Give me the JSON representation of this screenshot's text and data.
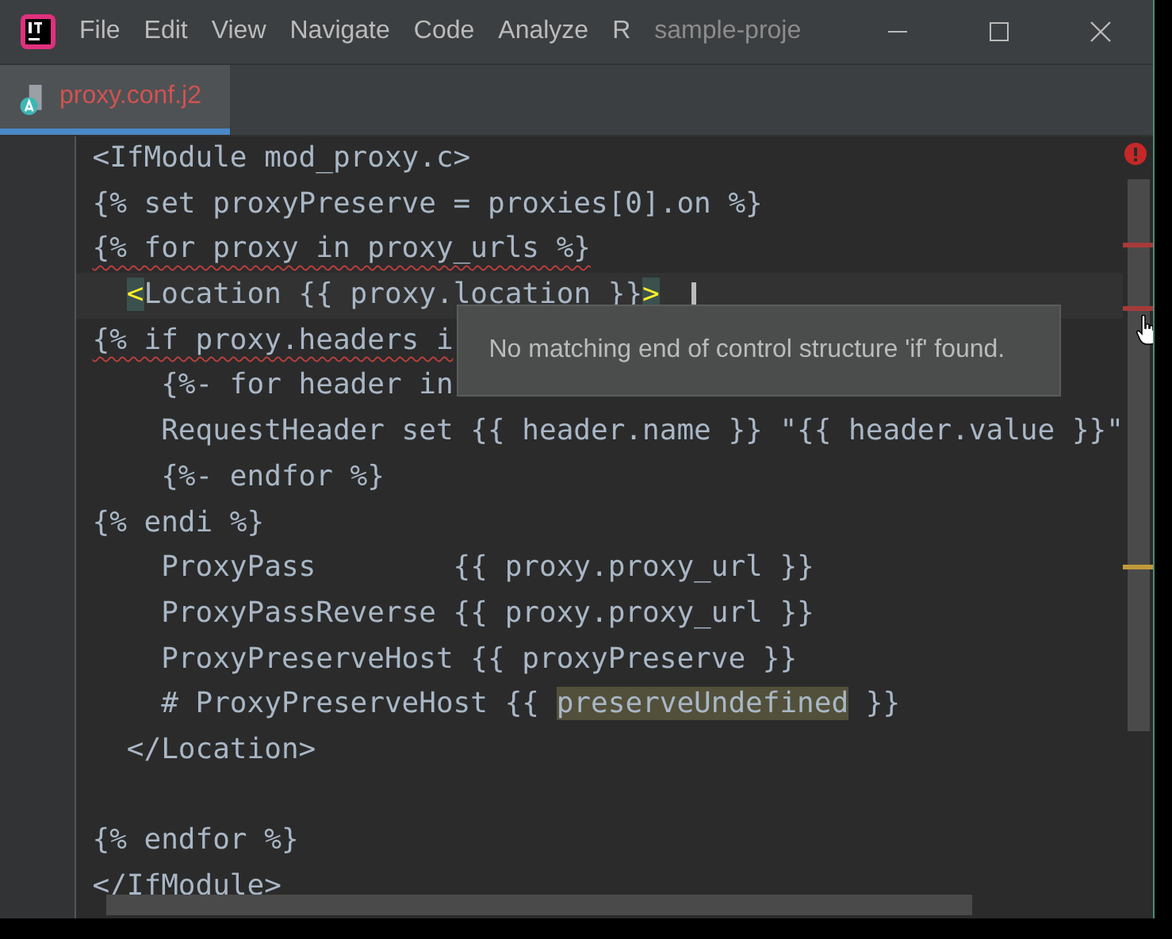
{
  "menu": [
    "File",
    "Edit",
    "View",
    "Navigate",
    "Code",
    "Analyze",
    "R"
  ],
  "project_title": "sample-proje",
  "tabs": [
    {
      "label": "proxy.conf.j2",
      "selected": true
    }
  ],
  "editor": {
    "lines": [
      {
        "segments": [
          {
            "text": "<IfModule mod_proxy.c>",
            "kind": "text"
          }
        ],
        "current": false,
        "error": false
      },
      {
        "segments": [
          {
            "text": "{% set proxyPreserve = proxies[0].on %}",
            "kind": "text"
          }
        ],
        "current": false,
        "error": false
      },
      {
        "segments": [
          {
            "text": "{% for proxy in proxy_urls %}",
            "kind": "text"
          }
        ],
        "current": false,
        "error": true
      },
      {
        "segments": [
          {
            "text": "  <",
            "kind": "brace-match"
          },
          {
            "text": "Location {{ proxy.location }}",
            "kind": "text"
          },
          {
            "text": ">",
            "kind": "brace-match"
          }
        ],
        "current": true,
        "error": false
      },
      {
        "segments": [
          {
            "text": "{% if proxy.headers i",
            "kind": "text"
          }
        ],
        "current": false,
        "error": true
      },
      {
        "segments": [
          {
            "text": "    {%- for header in",
            "kind": "text"
          }
        ],
        "current": false,
        "error": false
      },
      {
        "segments": [
          {
            "text": "    RequestHeader set {{ header.name }} \"{{ header.value }}\"",
            "kind": "text"
          }
        ],
        "current": false,
        "error": false
      },
      {
        "segments": [
          {
            "text": "    {%- endfor %}",
            "kind": "text"
          }
        ],
        "current": false,
        "error": false
      },
      {
        "segments": [
          {
            "text": "{% endi %}",
            "kind": "text"
          }
        ],
        "current": false,
        "error": false
      },
      {
        "segments": [
          {
            "text": "    ProxyPass        {{ proxy.proxy_url }}",
            "kind": "text"
          }
        ],
        "current": false,
        "error": false
      },
      {
        "segments": [
          {
            "text": "    ProxyPassReverse {{ proxy.proxy_url }}",
            "kind": "text"
          }
        ],
        "current": false,
        "error": false
      },
      {
        "segments": [
          {
            "text": "    ProxyPreserveHost {{ proxyPreserve }}",
            "kind": "text"
          }
        ],
        "current": false,
        "error": false
      },
      {
        "segments": [
          {
            "text": "    # ProxyPreserveHost {{ ",
            "kind": "text"
          },
          {
            "text": "preserveUndefined",
            "kind": "usage-highlight"
          },
          {
            "text": " }}",
            "kind": "text"
          }
        ],
        "current": false,
        "error": false
      },
      {
        "segments": [
          {
            "text": "  </Location>",
            "kind": "text"
          }
        ],
        "current": false,
        "error": false
      },
      {
        "current": false
      },
      {
        "segments": [
          {
            "text": "{% endfor %}",
            "kind": "text"
          }
        ],
        "current": false,
        "error": false
      },
      {
        "segments": [
          {
            "text": "</IfModule>",
            "kind": "text"
          }
        ],
        "current": false,
        "error": false
      }
    ],
    "tooltip": "No matching end of control structure 'if' found."
  }
}
